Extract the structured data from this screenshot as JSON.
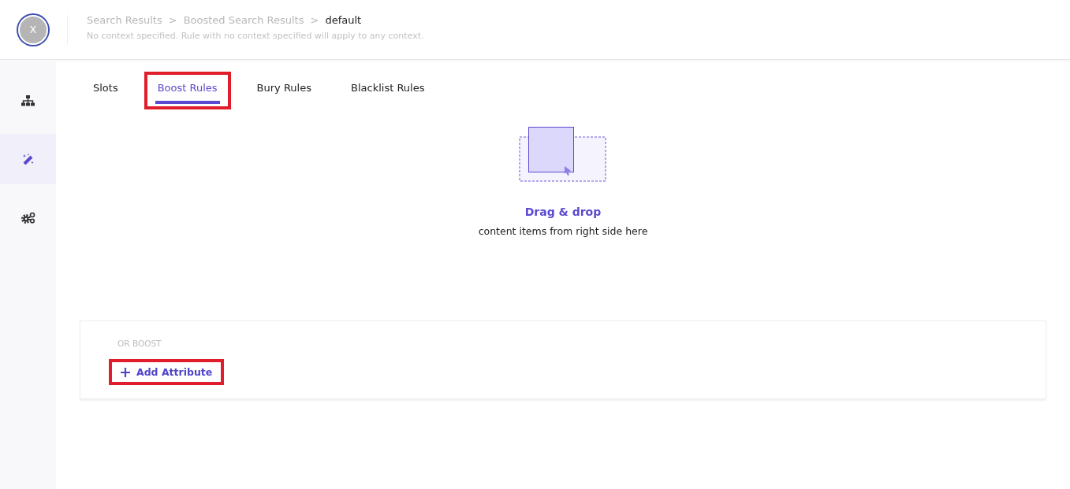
{
  "header": {
    "avatar": "X",
    "breadcrumbs": [
      {
        "kind": "crumb",
        "label": "Search Results",
        "current": false
      },
      {
        "kind": "separator",
        "label": ">"
      },
      {
        "kind": "crumb",
        "label": "Boosted Search Results",
        "current": false
      },
      {
        "kind": "separator",
        "label": ">"
      },
      {
        "kind": "crumb",
        "label": "default",
        "current": true
      }
    ],
    "note": "No context specified. Rule with no context specified will apply to any context."
  },
  "sidebar": {
    "items": [
      {
        "kind": "hierarchy",
        "selected": false
      },
      {
        "kind": "wand",
        "selected": true
      },
      {
        "kind": "gears",
        "selected": false
      }
    ]
  },
  "tabs": [
    {
      "label": "Slots",
      "selected": false,
      "highlighted": false
    },
    {
      "label": "Boost Rules",
      "selected": true,
      "highlighted": true
    },
    {
      "label": "Bury Rules",
      "selected": false,
      "highlighted": false
    },
    {
      "label": "Blacklist Rules",
      "selected": false,
      "highlighted": false
    }
  ],
  "dropzone": {
    "title": "Drag & drop",
    "subtitle": "content items from right side here"
  },
  "boost_card": {
    "heading": "OR BOOST",
    "button": {
      "label": "Add Attribute",
      "highlighted": true
    }
  }
}
